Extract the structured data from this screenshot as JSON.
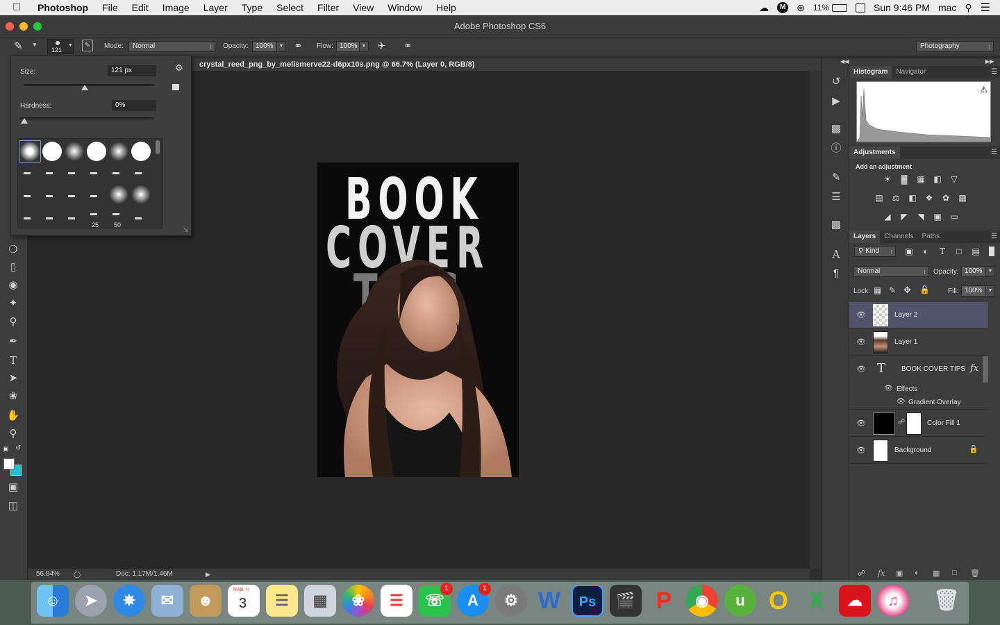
{
  "menubar": {
    "apple": "",
    "app_name": "Photoshop",
    "items": [
      "File",
      "Edit",
      "Image",
      "Layer",
      "Type",
      "Select",
      "Filter",
      "View",
      "Window",
      "Help"
    ],
    "battery": "11%",
    "clock": "Sun 9:46 PM",
    "user": "mac"
  },
  "window": {
    "title": "Adobe Photoshop CS6",
    "traffic_colors": [
      "#fc5f57",
      "#fdbc2e",
      "#28c840"
    ]
  },
  "options_bar": {
    "brush_size_preview": "121",
    "mode_label": "Mode:",
    "mode_value": "Normal",
    "opacity_label": "Opacity:",
    "opacity_value": "100%",
    "flow_label": "Flow:",
    "flow_value": "100%",
    "workspace": "Photography"
  },
  "brush_popup": {
    "size_label": "Size:",
    "size_value": "121 px",
    "size_level": 0.47,
    "hardness_label": "Hardness:",
    "hardness_value": "0%",
    "hardness_level": 0.0,
    "preset_labels": [
      "25",
      "50"
    ]
  },
  "document": {
    "tab_title": "crystal_reed_png_by_melismerve22-d6px10s.png @ 66.7% (Layer 0, RGB/8)",
    "art_lines": [
      "BOOK",
      "COVER",
      "TIPS"
    ]
  },
  "status": {
    "zoom": "56.84%",
    "doc_size": "Doc: 1.17M/1.46M"
  },
  "histogram_panel": {
    "tabs": [
      "Histogram",
      "Navigator"
    ]
  },
  "adjustments_panel": {
    "tab": "Adjustments",
    "heading": "Add an adjustment"
  },
  "layers_panel": {
    "tabs": [
      "Layers",
      "Channels",
      "Paths"
    ],
    "filter_kind": "Kind",
    "blend_mode": "Normal",
    "opacity_label": "Opacity:",
    "opacity_value": "100%",
    "lock_label": "Lock:",
    "fill_label": "Fill:",
    "fill_value": "100%",
    "layers": [
      {
        "name": "Layer 2"
      },
      {
        "name": "Layer 1"
      },
      {
        "name": "BOOK COVER TIPS"
      },
      {
        "name": "Effects"
      },
      {
        "name": "Gradient Overlay"
      },
      {
        "name": "Color Fill 1"
      },
      {
        "name": "Background"
      }
    ],
    "fx_label": "fx"
  },
  "dock": {
    "calendar_month": "RAB. II",
    "calendar_day": "3",
    "facetime_badge": "1",
    "appstore_badge": "1",
    "word_letter": "W",
    "ps_letters": "Ps"
  },
  "colors": {
    "accent_selected_layer": "#50536a",
    "foreground": "#ffffff",
    "background_swatch": "#20c0d0"
  }
}
